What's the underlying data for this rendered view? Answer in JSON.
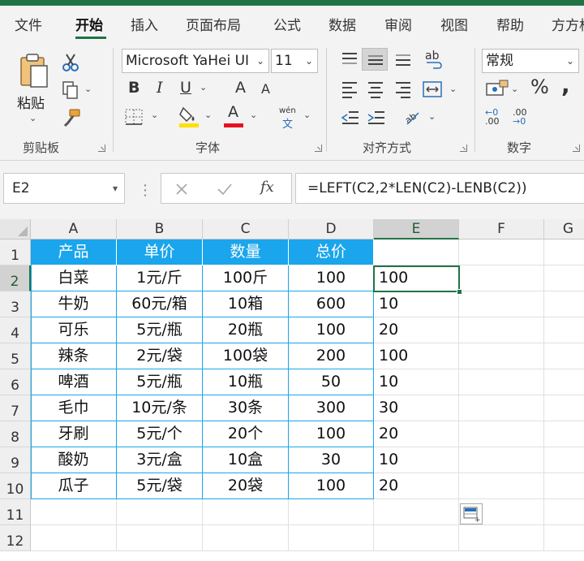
{
  "menu": {
    "tabs": [
      "文件",
      "开始",
      "插入",
      "页面布局",
      "公式",
      "数据",
      "审阅",
      "视图",
      "帮助",
      "方方格子"
    ],
    "active_tab": "开始"
  },
  "ribbon": {
    "clipboard": {
      "paste_label": "粘贴",
      "group_label": "剪贴板"
    },
    "font": {
      "font_name": "Microsoft YaHei UI",
      "font_size": "11",
      "bold": "B",
      "italic": "I",
      "underline": "U",
      "grow": "A",
      "shrink": "A",
      "pinyin_top": "wén",
      "pinyin_char": "文",
      "fill_letter": "",
      "font_color_letter": "A",
      "group_label": "字体",
      "fill_color": "#ffe000",
      "font_color": "#e81123"
    },
    "alignment": {
      "wrap_glyph": "ab",
      "group_label": "对齐方式"
    },
    "number": {
      "format": "常规",
      "percent": "%",
      "comma": ",",
      "inc_decimal_top": "←0",
      "inc_decimal_bottom": ".00",
      "dec_decimal_top": ".00",
      "dec_decimal_bottom": "→0",
      "group_label": "数字"
    }
  },
  "formula_bar": {
    "name_box": "E2",
    "fx": "fx",
    "formula": "=LEFT(C2,2*LEN(C2)-LENB(C2))"
  },
  "sheet": {
    "columns": [
      "A",
      "B",
      "C",
      "D",
      "E",
      "F",
      "G"
    ],
    "rows": [
      "1",
      "2",
      "3",
      "4",
      "5",
      "6",
      "7",
      "8",
      "9",
      "10",
      "11",
      "12"
    ],
    "header_row": [
      "产品",
      "单价",
      "数量",
      "总价"
    ],
    "data": [
      [
        "白菜",
        "1元/斤",
        "100斤",
        "100",
        "100"
      ],
      [
        "牛奶",
        "60元/箱",
        "10箱",
        "600",
        "10"
      ],
      [
        "可乐",
        "5元/瓶",
        "20瓶",
        "100",
        "20"
      ],
      [
        "辣条",
        "2元/袋",
        "100袋",
        "200",
        "100"
      ],
      [
        "啤酒",
        "5元/瓶",
        "10瓶",
        "50",
        "10"
      ],
      [
        "毛巾",
        "10元/条",
        "30条",
        "300",
        "30"
      ],
      [
        "牙刷",
        "5元/个",
        "20个",
        "100",
        "20"
      ],
      [
        "酸奶",
        "3元/盒",
        "10盒",
        "30",
        "10"
      ],
      [
        "瓜子",
        "5元/袋",
        "20袋",
        "100",
        "20"
      ]
    ],
    "selected_cell": "E2",
    "header_color": "#1aa5ec",
    "accent_color": "#217346"
  }
}
